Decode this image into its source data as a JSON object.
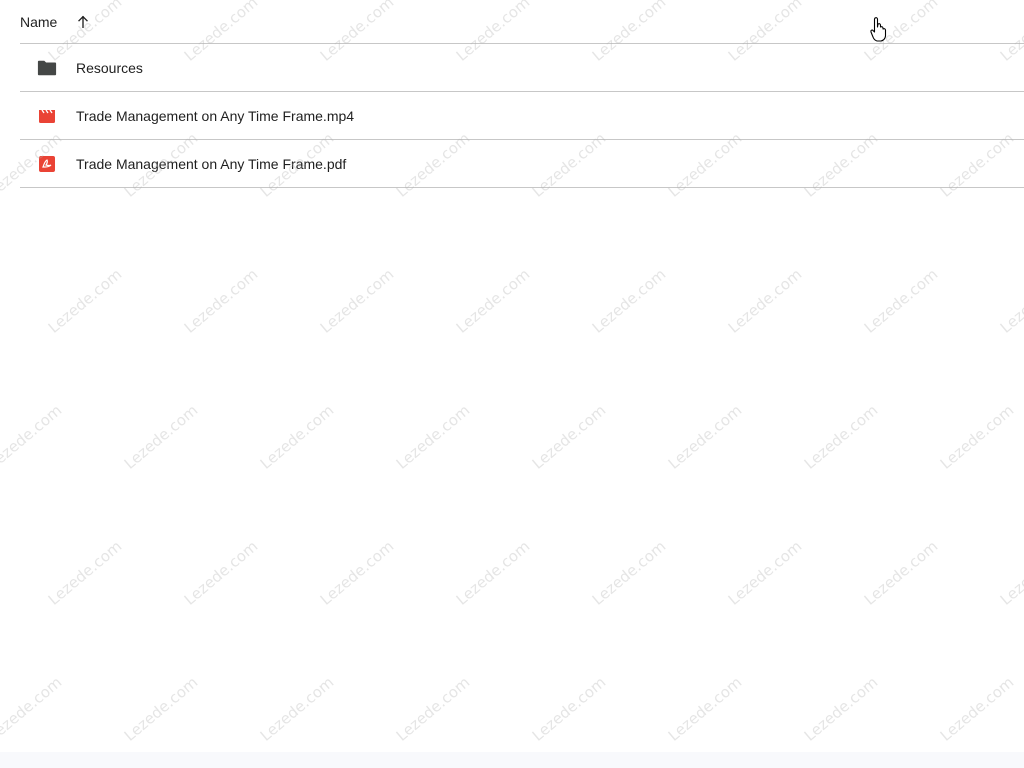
{
  "header": {
    "name_label": "Name",
    "sort_icon": "arrow-up-icon"
  },
  "files": [
    {
      "name": "Resources",
      "icon": "folder-icon",
      "type": "folder"
    },
    {
      "name": "Trade Management on Any Time Frame.mp4",
      "icon": "video-icon",
      "type": "video"
    },
    {
      "name": "Trade Management on Any Time Frame.pdf",
      "icon": "pdf-icon",
      "type": "pdf"
    }
  ],
  "watermark": {
    "text": "Lezede.com"
  },
  "colors": {
    "folder": "#444746",
    "video": "#ea4335",
    "pdf": "#ea4335",
    "divider": "#c7c7c7",
    "text": "#1f1f1f",
    "watermark": "#b4b4b4"
  },
  "cursor_icon": "hand-pointer-icon"
}
